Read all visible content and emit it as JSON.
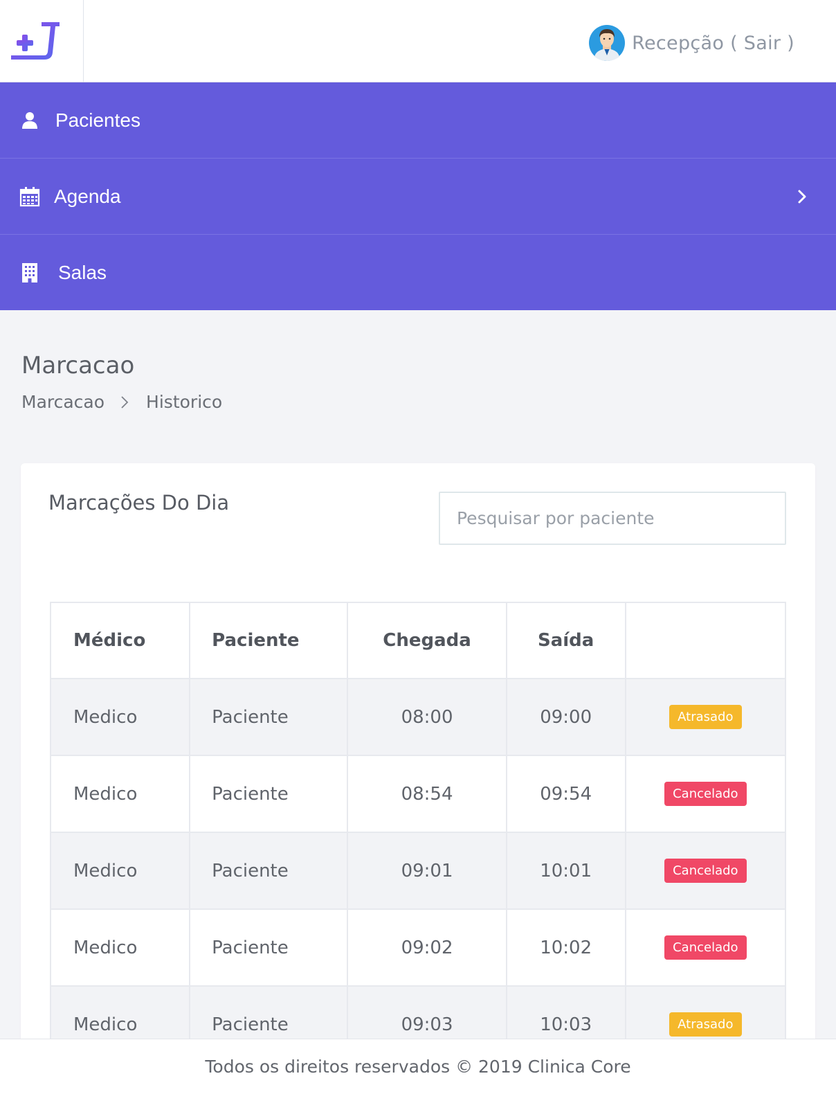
{
  "header": {
    "logo_icon": "plus-j-logo-icon",
    "user_label": "Recepção ( Sair )",
    "avatar_icon": "doctor-avatar-icon"
  },
  "nav": {
    "items": [
      {
        "label": "Pacientes",
        "icon": "user-icon"
      },
      {
        "label": "Agenda",
        "icon": "calendar-icon",
        "has_submenu": true
      },
      {
        "label": "Salas",
        "icon": "building-icon"
      }
    ]
  },
  "page": {
    "title": "Marcacao",
    "breadcrumb": [
      "Marcacao",
      "Historico"
    ]
  },
  "card": {
    "title": "Marcações Do Dia",
    "search_placeholder": "Pesquisar por paciente",
    "table": {
      "headers": [
        "Médico",
        "Paciente",
        "Chegada",
        "Saída",
        ""
      ],
      "rows": [
        {
          "medico": "Medico",
          "paciente": "Paciente",
          "chegada": "08:00",
          "saida": "09:00",
          "status": "Atrasado"
        },
        {
          "medico": "Medico",
          "paciente": "Paciente",
          "chegada": "08:54",
          "saida": "09:54",
          "status": "Cancelado"
        },
        {
          "medico": "Medico",
          "paciente": "Paciente",
          "chegada": "09:01",
          "saida": "10:01",
          "status": "Cancelado"
        },
        {
          "medico": "Medico",
          "paciente": "Paciente",
          "chegada": "09:02",
          "saida": "10:02",
          "status": "Cancelado"
        },
        {
          "medico": "Medico",
          "paciente": "Paciente",
          "chegada": "09:03",
          "saida": "10:03",
          "status": "Atrasado"
        }
      ]
    }
  },
  "footer": {
    "text": "Todos os direitos reservados © 2019 Clinica Core"
  },
  "colors": {
    "nav_bg": "#645bdc",
    "logo_gradient_start": "#7b4ee8",
    "logo_gradient_end": "#5b6ff0",
    "badge_atrasado": "#f5b82b",
    "badge_cancelado": "#f04866"
  }
}
